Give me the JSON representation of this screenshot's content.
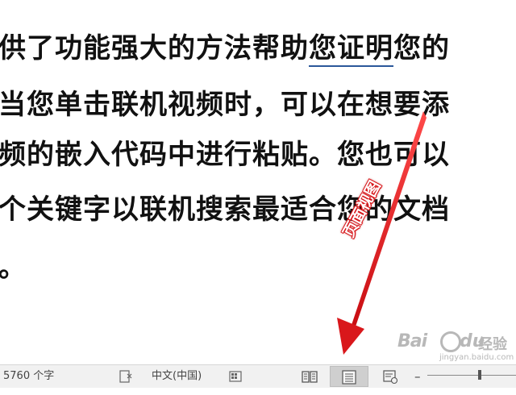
{
  "document": {
    "lines": [
      {
        "prefix": "供了功能强大的方法帮助",
        "underlined": "您证明",
        "suffix": "您的"
      },
      {
        "text": "当您单击联机视频时，可以在想要添"
      },
      {
        "text": "频的嵌入代码中进行粘贴。您也可以"
      },
      {
        "text": "个关键字以联机搜索最适合您的文档"
      },
      {
        "text": "。"
      }
    ]
  },
  "annotation": {
    "label": "页面视图",
    "color": "#e8141b"
  },
  "watermark": {
    "bai": "Bai",
    "du": "du",
    "jingyan": "经验",
    "url": "jingyan.baidu.com"
  },
  "status_bar": {
    "word_count": "5760 个字",
    "language": "中文(中国)",
    "zoom_minus": "–",
    "icons": {
      "proofing": "proofing-icon",
      "macro": "macro-recording-icon",
      "read_mode": "read-mode-icon",
      "print_layout": "print-layout-icon",
      "web_layout": "web-layout-icon"
    },
    "active_view": "print-layout",
    "colors": {
      "background": "#f1f1f1",
      "active_view_bg": "#cfcfcf"
    }
  }
}
